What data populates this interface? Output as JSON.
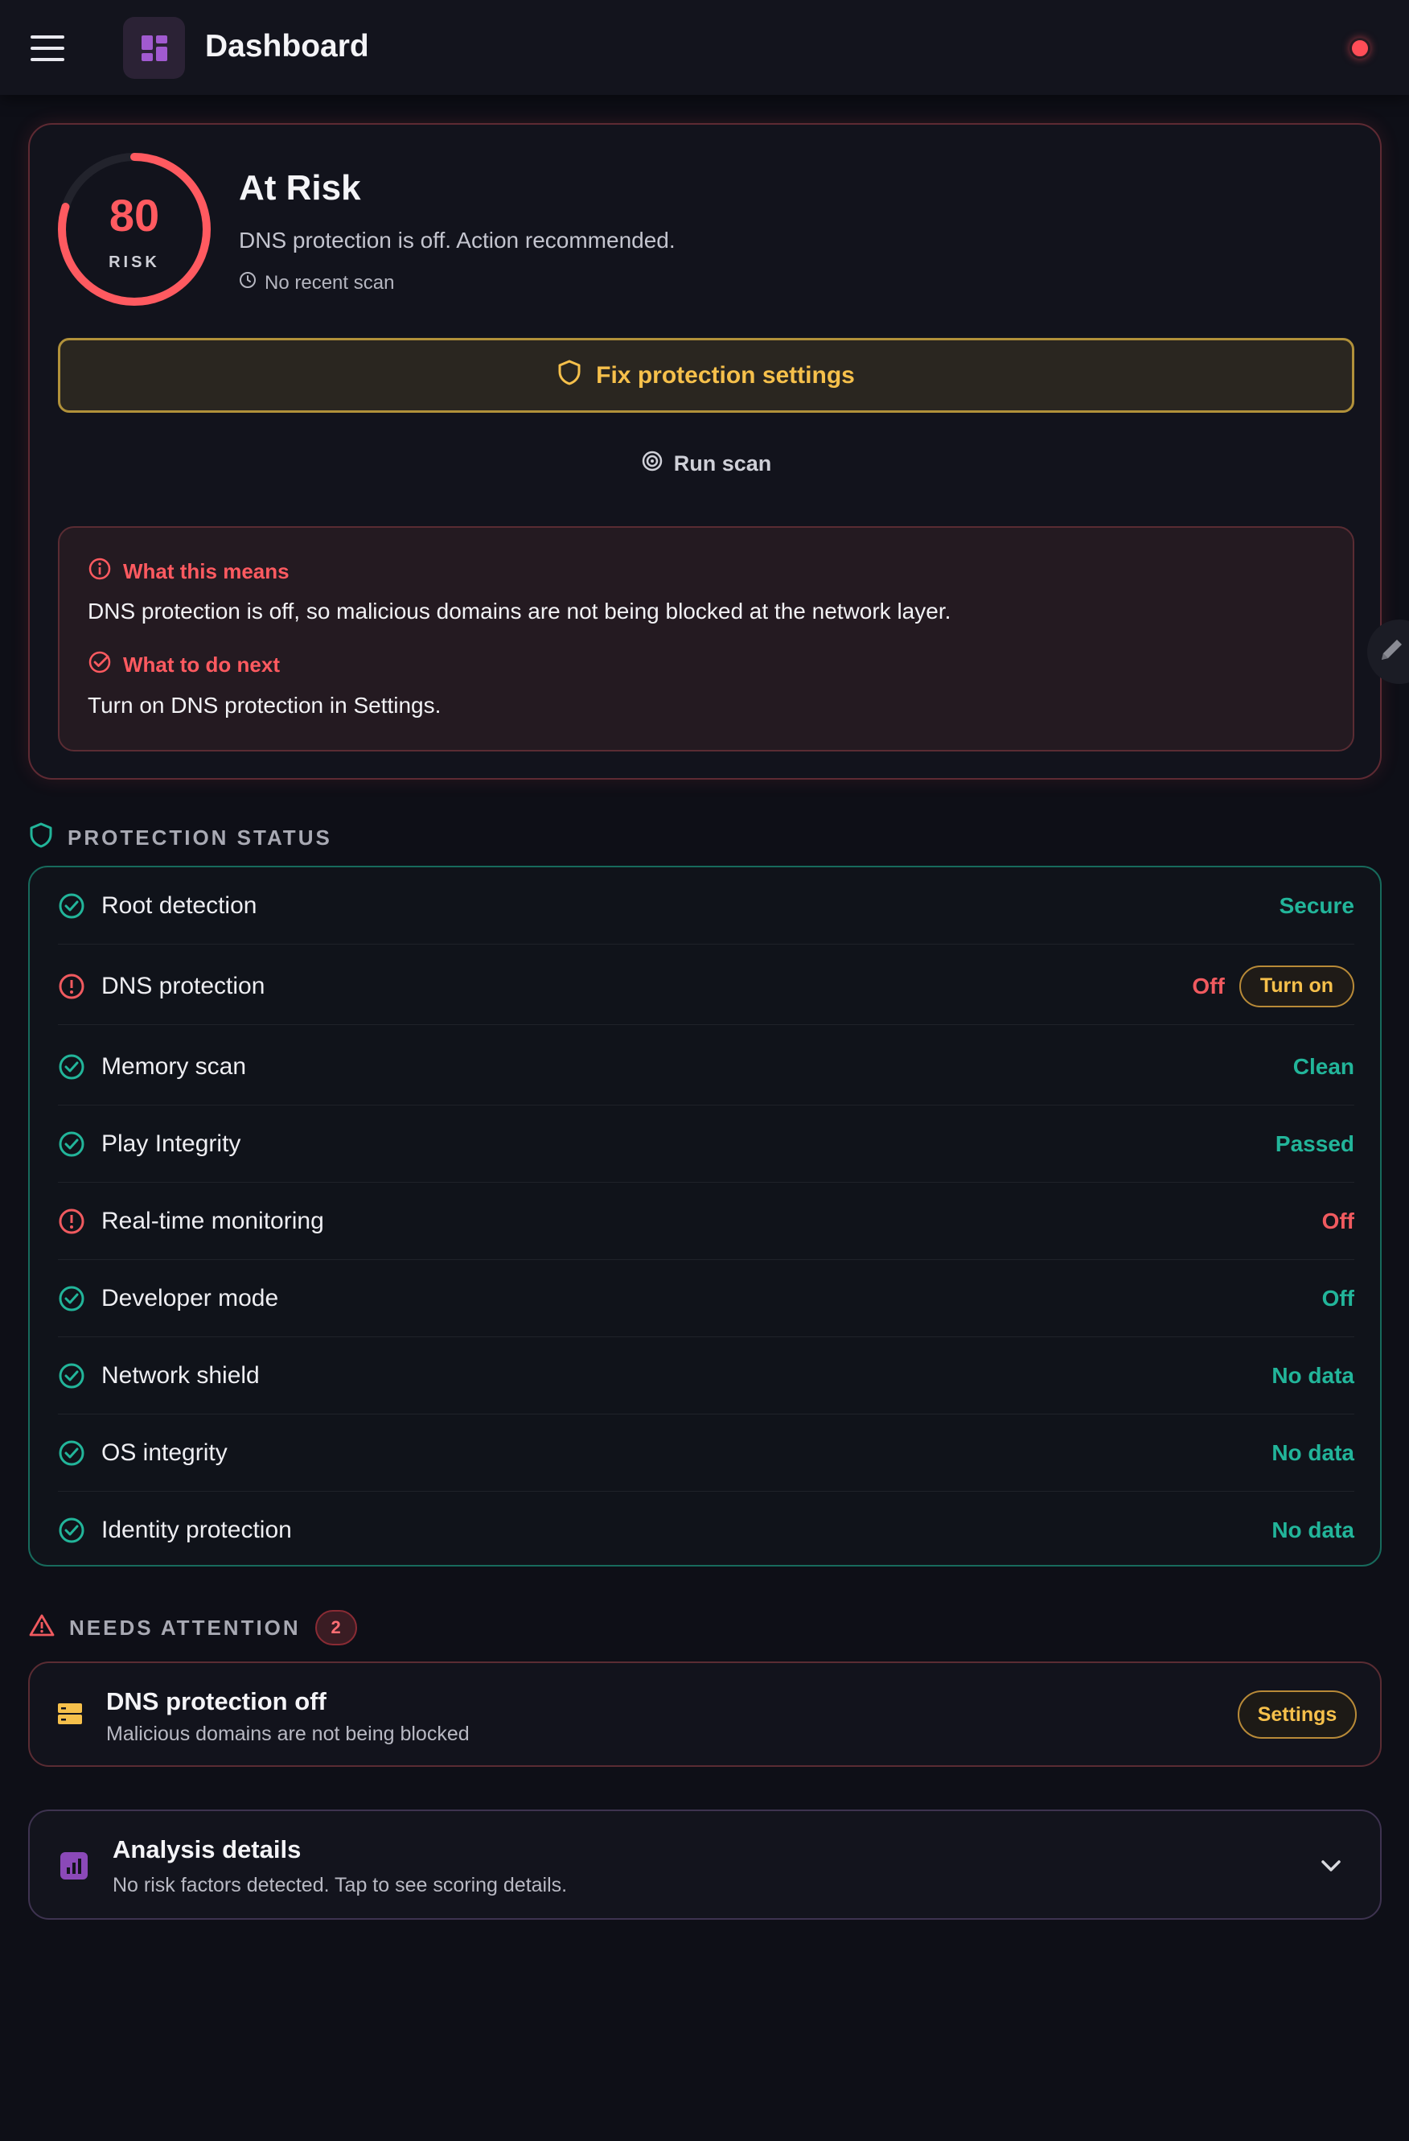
{
  "header": {
    "title": "Dashboard"
  },
  "risk": {
    "score": "80",
    "score_label": "RISK",
    "status_title": "At Risk",
    "description": "DNS protection is off. Action recommended.",
    "scan_meta": "No recent scan",
    "fix_button": "Fix protection settings",
    "run_scan": "Run scan",
    "what_means_heading": "What this means",
    "what_means_text": "DNS protection is off, so malicious domains are not being blocked at the network layer.",
    "next_heading": "What to do next",
    "next_text": "Turn on DNS protection in Settings."
  },
  "protection": {
    "heading": "PROTECTION STATUS",
    "rows": [
      {
        "label": "Root detection",
        "value": "Secure",
        "state": "ok"
      },
      {
        "label": "DNS protection",
        "value": "Off",
        "state": "bad",
        "action": "Turn on"
      },
      {
        "label": "Memory scan",
        "value": "Clean",
        "state": "ok"
      },
      {
        "label": "Play Integrity",
        "value": "Passed",
        "state": "ok"
      },
      {
        "label": "Real-time monitoring",
        "value": "Off",
        "state": "bad"
      },
      {
        "label": "Developer mode",
        "value": "Off",
        "state": "ok"
      },
      {
        "label": "Network shield",
        "value": "No data",
        "state": "ok"
      },
      {
        "label": "OS integrity",
        "value": "No data",
        "state": "ok"
      },
      {
        "label": "Identity protection",
        "value": "No data",
        "state": "ok"
      }
    ]
  },
  "attention": {
    "heading": "NEEDS ATTENTION",
    "count": "2",
    "item_title": "DNS protection off",
    "item_subtitle": "Malicious domains are not being blocked",
    "item_button": "Settings"
  },
  "analysis": {
    "title": "Analysis details",
    "subtitle": "No risk factors detected. Tap to see scoring details."
  },
  "colors": {
    "danger": "#ff5a60",
    "success": "#22b59a",
    "warning": "#f6c04b",
    "accent": "#8b49b8"
  },
  "icons": {
    "menu": "hamburger-icon",
    "app": "dashboard-grid-icon",
    "status": "alert-dot-icon",
    "clock": "clock-icon",
    "shield": "shield-icon",
    "scan": "radar-icon",
    "info": "info-circle-icon",
    "check": "check-circle-icon",
    "alert": "alert-circle-icon",
    "warning": "warning-triangle-icon",
    "server": "server-icon",
    "chart": "bar-chart-icon",
    "chevron": "chevron-down-icon",
    "edit": "pencil-icon"
  }
}
